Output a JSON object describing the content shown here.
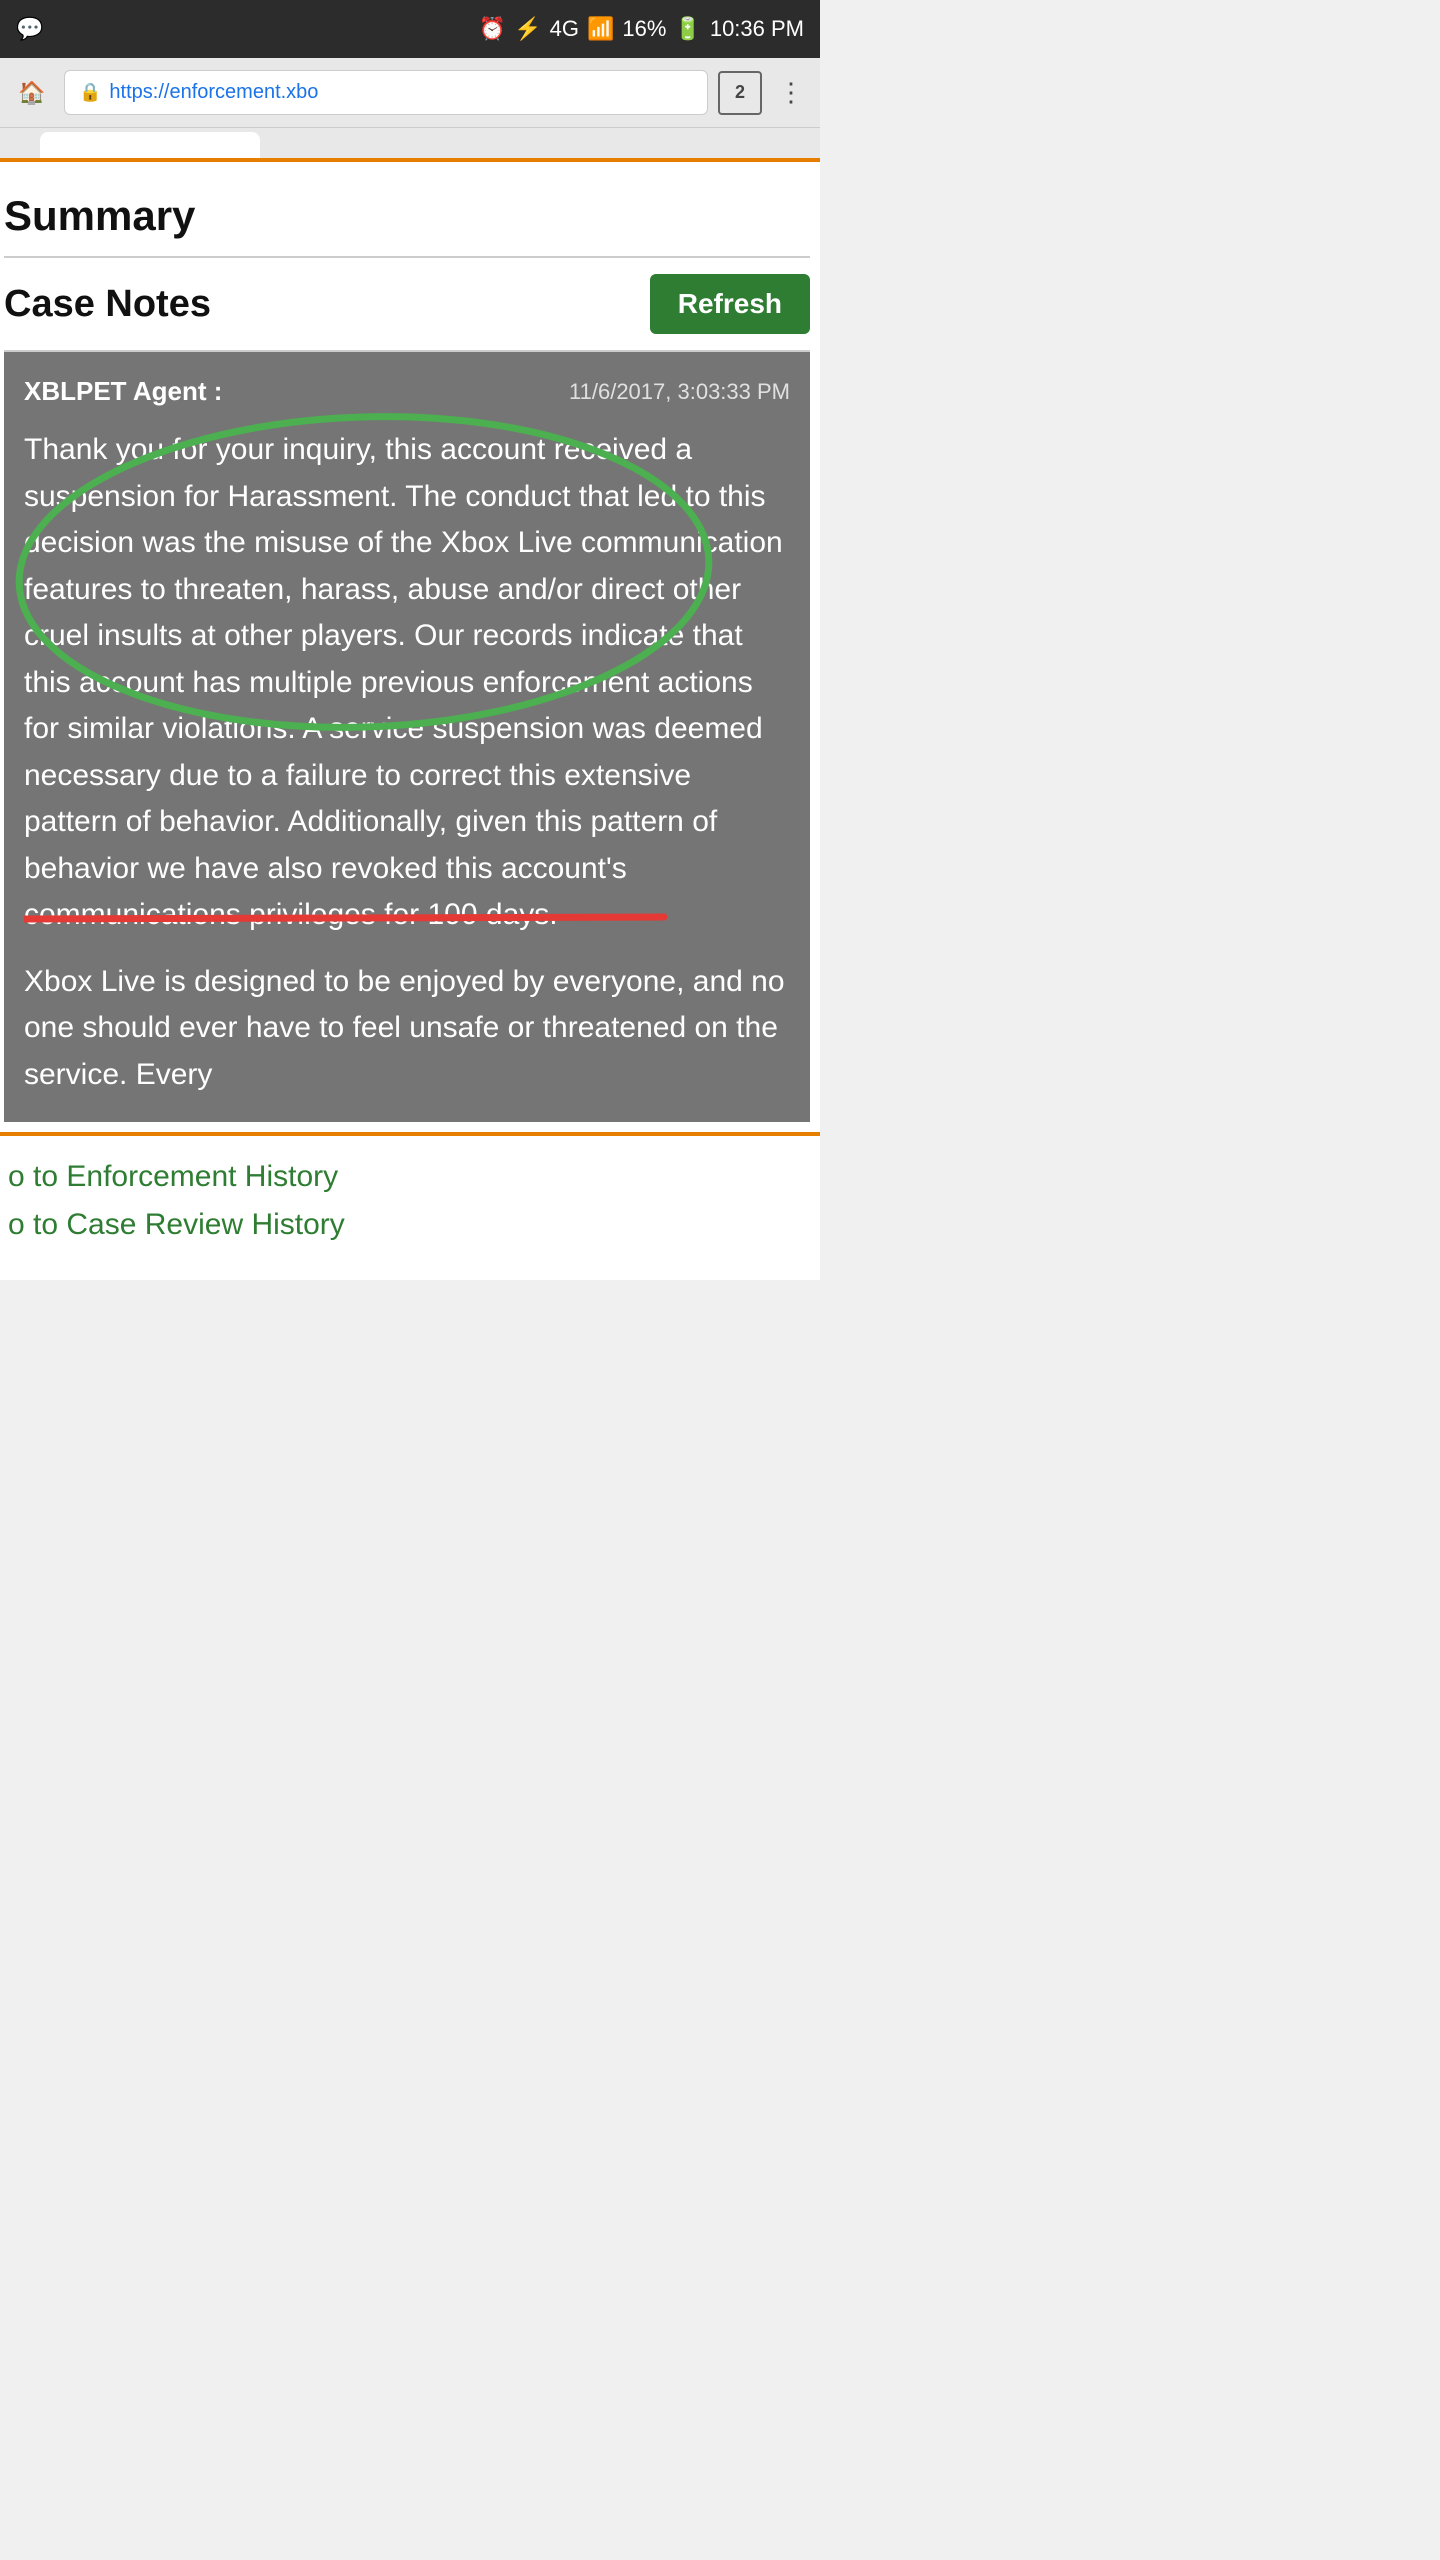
{
  "statusBar": {
    "battery": "16%",
    "time": "10:36 PM",
    "signal": "4G"
  },
  "browser": {
    "url": "https://enforcement.xbo",
    "tabCount": "2"
  },
  "page": {
    "summaryTitle": "Summary",
    "caseNotesLabel": "Case Notes",
    "refreshButton": "Refresh",
    "agent": {
      "label": "XBLPET Agent :",
      "date": "11/6/2017, 3:03:33 PM"
    },
    "messagePart1": "Thank you for your inquiry, this account received a suspension for Harassment. The conduct that led to this decision was the misuse of the Xbox Live communication features to threaten, harass, abuse and/or direct other cruel insults at other players. Our records indicate that this account has multiple previous enforcement actions for similar violations. A service suspension was deemed necessary due to a failure to correct this extensive pattern of behavior. Additionally, given this pattern of behavior we have also revoked this account's communications privileges for 100 days.",
    "messagePart2": "Xbox Live is designed to be enjoyed by everyone, and no one should ever have to feel unsafe or threatened on the service. Every",
    "links": {
      "enforcement": "o to Enforcement History",
      "caseReview": "o to Case Review History"
    }
  }
}
